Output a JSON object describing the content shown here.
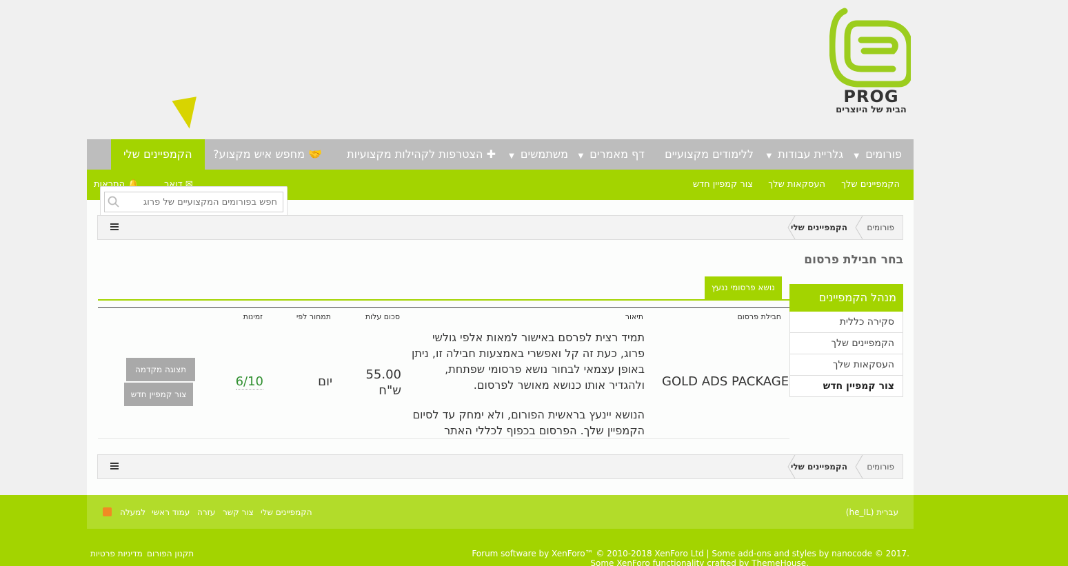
{
  "logo": {
    "name": "PROG",
    "tagline": "הבית של היוצרים"
  },
  "nav": {
    "items": [
      {
        "label": "פורומים",
        "dropdown": true
      },
      {
        "label": "גלריית עבודות",
        "dropdown": true
      },
      {
        "label": "ללימודים מקצועיים",
        "dropdown": false
      },
      {
        "label": "דף מאמרים",
        "dropdown": true
      },
      {
        "label": "משתמשים",
        "dropdown": true
      },
      {
        "label": "הצטרפות לקהילות מקצועיות",
        "dropdown": false
      },
      {
        "label": "מחפש איש מקצוע?",
        "dropdown": false
      },
      {
        "label": "הקמפיינים שלי",
        "dropdown": false,
        "active": true
      }
    ]
  },
  "subnav": {
    "links": [
      "הקמפיינים שלך",
      "העסקאות שלך",
      "צור קמפיין חדש"
    ],
    "inbox": "דואר",
    "alerts": "התראות"
  },
  "search": {
    "placeholder": "חפש בפורומים המקצועיים של פרוג"
  },
  "breadcrumb": {
    "root": "פורומים",
    "current": "הקמפיינים שלי"
  },
  "page_title": "בחר חבילת פרסום",
  "sidebar": {
    "title": "מנהל הקמפיינים",
    "links": [
      "סקירה כללית",
      "הקמפיינים שלך",
      "העסקאות שלך",
      "צור קמפיין חדש"
    ]
  },
  "tab": {
    "label": "נושא פרסומי ננעץ"
  },
  "table": {
    "headers": {
      "package": "חבילת פרסום",
      "description": "תיאור",
      "cost": "סכום עלות",
      "price_per": "תמחור לפי",
      "availability": "זמינות"
    },
    "row": {
      "package": "GOLD ADS PACKAGE",
      "description_1": "תמיד רצית לפרסם באישור למאות אלפי גולשי פרוג, כעת זה קל ואפשרי באמצעות חבילה זו, ניתן באופן עצמאי לבחור נושא פרסומי שפתחת, ולהגדיר אותו כנושא מאושר לפרסום.",
      "description_2": "הנושא יינעץ בראשית הפורום, ולא ימחק עד לסיום הקמפיין שלך. הפרסום בכפוף לכללי האתר",
      "cost": "55.00 ש\"ח",
      "price_per": "יום",
      "availability": "6/10",
      "preview_button": "תצוגה מקדמה",
      "create_button": "צור קמפיין חדש"
    }
  },
  "footer": {
    "language": "עברית (he_IL)",
    "links": [
      "הקמפיינים שלי",
      "צור קשר",
      "עזרה",
      "עמוד ראשי",
      "למעלה"
    ],
    "copyright_line1": "Forum software by XenForo™ © 2010-2018 XenForo Ltd | Some add-ons and styles by nanocode © 2017.",
    "copyright_line2": "Some XenForo functionality crafted by ThemeHouse.",
    "legal_links": [
      "תקנון הפורום",
      "מדיניות פרטיות"
    ]
  },
  "colors": {
    "accent": "#a3d400",
    "nav_gray": "#bdbdbd",
    "pointer": "#d8d400",
    "availability": "#2f8f2f"
  }
}
